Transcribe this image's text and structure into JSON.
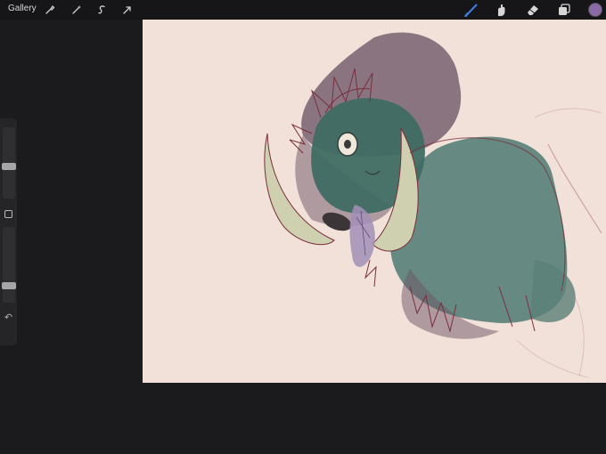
{
  "toolbar": {
    "gallery_label": "Gallery",
    "left_tools": [
      {
        "name": "actions",
        "icon": "wrench-icon"
      },
      {
        "name": "adjustments",
        "icon": "magic-wand-icon"
      },
      {
        "name": "selection",
        "icon": "selection-s-icon"
      },
      {
        "name": "transform",
        "icon": "arrow-cursor-icon"
      }
    ],
    "right_tools": [
      {
        "name": "brush",
        "icon": "brush-icon",
        "active": true
      },
      {
        "name": "smudge",
        "icon": "smudge-finger-icon",
        "active": false
      },
      {
        "name": "eraser",
        "icon": "eraser-icon",
        "active": false
      },
      {
        "name": "layers",
        "icon": "layers-icon",
        "active": false
      }
    ],
    "current_color": "#8a6aa6"
  },
  "sidebar": {
    "brush_size_level": 0.45,
    "opacity_level": 0.2,
    "modify_icon": "square-icon",
    "undo_icon": "undo-arrow-icon"
  },
  "colors": {
    "accent": "#3d7ee6",
    "paper": "#f2e1d8",
    "creature_teal": "#4e7a72",
    "smoke_purple": "#5f4a5e",
    "horn": "#cfd0b0",
    "line_art": "#7a2e3e"
  }
}
